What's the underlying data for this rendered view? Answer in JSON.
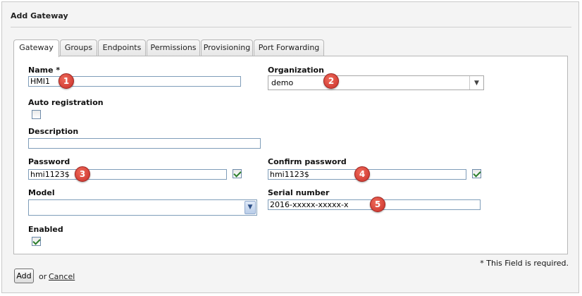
{
  "dialog": {
    "title": "Add Gateway"
  },
  "tabs": [
    {
      "label": "Gateway",
      "active": true
    },
    {
      "label": "Groups"
    },
    {
      "label": "Endpoints"
    },
    {
      "label": "Permissions"
    },
    {
      "label": "Provisioning"
    },
    {
      "label": "Port Forwarding"
    }
  ],
  "form": {
    "name": {
      "label": "Name *",
      "value": "HMI1"
    },
    "organization": {
      "label": "Organization",
      "value": "demo"
    },
    "auto_registration": {
      "label": "Auto registration",
      "checked": false
    },
    "description": {
      "label": "Description",
      "value": ""
    },
    "password": {
      "label": "Password",
      "value": "hmi1123$",
      "valid": true
    },
    "confirm_password": {
      "label": "Confirm password",
      "value": "hmi1123$",
      "valid": true
    },
    "model": {
      "label": "Model",
      "value": ""
    },
    "serial_number": {
      "label": "Serial number",
      "value": "2016-xxxxx-xxxxx-x"
    },
    "enabled": {
      "label": "Enabled",
      "checked": true
    }
  },
  "callouts": [
    "1",
    "2",
    "3",
    "4",
    "5"
  ],
  "footer": {
    "required_note": "* This Field is required.",
    "add_label": "Add",
    "or_text": "or",
    "cancel_label": "Cancel"
  },
  "icons": {
    "combo_arrow": "dropdown-arrow-icon",
    "check": "checkmark-icon"
  },
  "colors": {
    "callout": "#d63b30",
    "valid_check": "#2a7d2a"
  }
}
